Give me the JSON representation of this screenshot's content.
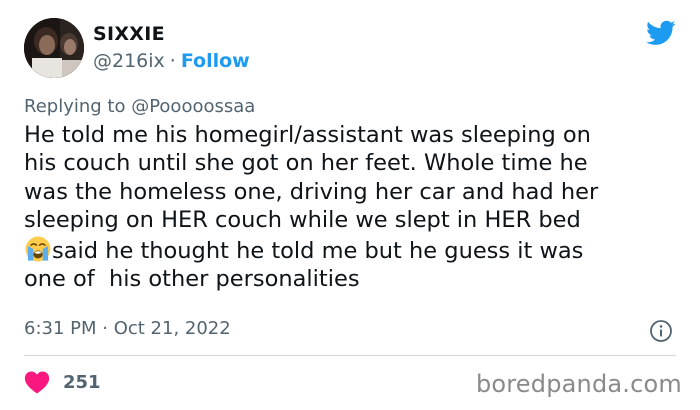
{
  "user": {
    "name": "SIXXIE",
    "handle": "@216ix",
    "separator": "·",
    "follow_label": "Follow"
  },
  "reply": {
    "prefix": "Replying to ",
    "mention": "@Pooooossaa"
  },
  "tweet": {
    "lines": [
      "He told me his homegirl/assistant was sleeping on",
      "his couch until she got on her feet. Whole time he",
      "was the homeless one, driving her car and had her",
      "sleeping on HER couch while we slept in HER bed",
      "said he thought he told me but he guess it was",
      "one of  his other personalities"
    ],
    "emoji": "loudly-crying-face-icon"
  },
  "meta": {
    "time": "6:31 PM",
    "separator": " · ",
    "date": "Oct 21, 2022"
  },
  "engagement": {
    "likes": "251"
  },
  "watermark": "boredpanda.com",
  "colors": {
    "accent": "#1d9bf0",
    "like": "#f91880",
    "secondary_text": "#536471",
    "divider": "#cfd9de"
  },
  "icons": {
    "brand": "twitter-bird-icon",
    "info": "info-icon",
    "like": "heart-icon"
  }
}
